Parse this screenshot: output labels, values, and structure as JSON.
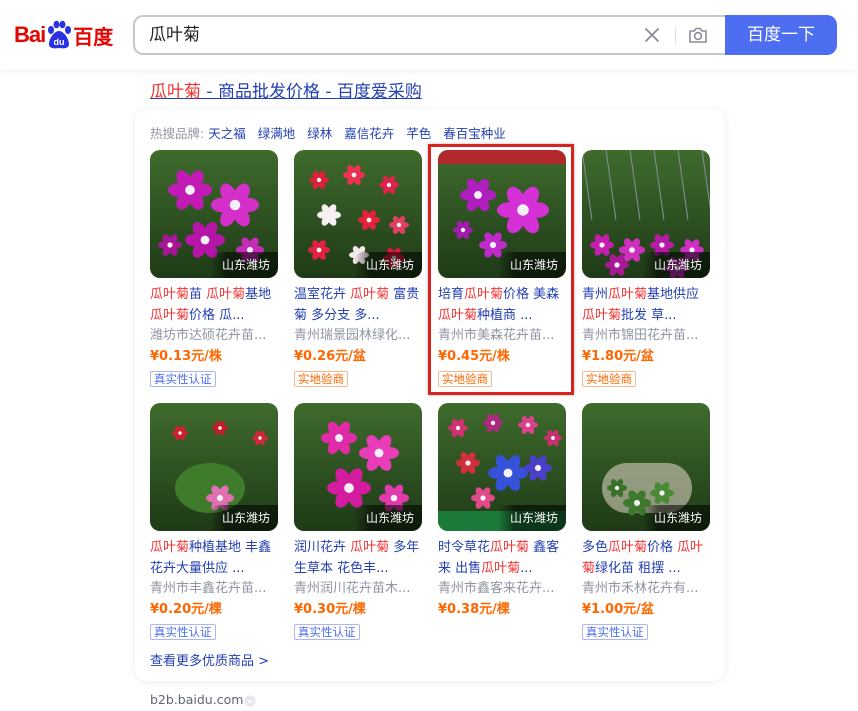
{
  "logo": {
    "bai": "Bai",
    "du": "百度"
  },
  "search": {
    "query": "瓜叶菊",
    "button": "百度一下"
  },
  "result": {
    "title_hl": "瓜叶菊",
    "title_rest": " - 商品批发价格 - 百度爱采购"
  },
  "hot_brands": {
    "label": "热搜品牌:",
    "items": [
      "天之福",
      "绿满地",
      "绿林",
      "嘉信花卉",
      "芊色",
      "春百宝种业"
    ]
  },
  "products": [
    {
      "location": "山东潍坊",
      "name_parts": [
        [
          "瓜叶菊",
          true
        ],
        [
          "苗 ",
          false
        ],
        [
          "瓜叶菊",
          true
        ],
        [
          "基地 ",
          false
        ],
        [
          "瓜叶菊",
          true
        ],
        [
          "价格 瓜...",
          false
        ]
      ],
      "seller": "潍坊市达硕花卉苗...",
      "price": "¥0.13元/株",
      "badge": "真实性认证",
      "badge_type": "auth"
    },
    {
      "location": "山东潍坊",
      "name_parts": [
        [
          "温室花卉 ",
          false
        ],
        [
          "瓜叶菊",
          true
        ],
        [
          " 富贵菊 多分支 多...",
          false
        ]
      ],
      "seller": "青州瑞景园林绿化...",
      "price": "¥0.26元/盆",
      "badge": "实地验商",
      "badge_type": "site"
    },
    {
      "location": "山东潍坊",
      "name_parts": [
        [
          "培育",
          false
        ],
        [
          "瓜叶菊",
          true
        ],
        [
          "价格 美森 ",
          false
        ],
        [
          "瓜叶菊",
          true
        ],
        [
          "种植商 ...",
          false
        ]
      ],
      "seller": "青州市美森花卉苗...",
      "price": "¥0.45元/株",
      "badge": "实地验商",
      "badge_type": "site"
    },
    {
      "location": "山东潍坊",
      "name_parts": [
        [
          "青州",
          false
        ],
        [
          "瓜叶菊",
          true
        ],
        [
          "基地供应 ",
          false
        ],
        [
          "瓜叶菊",
          true
        ],
        [
          "批发 草...",
          false
        ]
      ],
      "seller": "青州市锦田花卉苗...",
      "price": "¥1.80元/盆",
      "badge": "实地验商",
      "badge_type": "site"
    },
    {
      "location": "山东潍坊",
      "name_parts": [
        [
          "瓜叶菊",
          true
        ],
        [
          "种植基地 丰鑫花卉大量供应 ...",
          false
        ]
      ],
      "seller": "青州市丰鑫花卉苗...",
      "price": "¥0.20元/棵",
      "badge": "真实性认证",
      "badge_type": "auth"
    },
    {
      "location": "山东潍坊",
      "name_parts": [
        [
          "润川花卉 ",
          false
        ],
        [
          "瓜叶菊",
          true
        ],
        [
          " 多年生草本 花色丰...",
          false
        ]
      ],
      "seller": "青州润川花卉苗木...",
      "price": "¥0.30元/棵",
      "badge": "真实性认证",
      "badge_type": "auth"
    },
    {
      "location": "山东潍坊",
      "name_parts": [
        [
          "时令草花",
          false
        ],
        [
          "瓜叶菊",
          true
        ],
        [
          " 鑫客来 出售",
          false
        ],
        [
          "瓜叶菊",
          true
        ],
        [
          "...",
          false
        ]
      ],
      "seller": "青州市鑫客来花卉...",
      "price": "¥0.38元/棵",
      "badge": "",
      "badge_type": ""
    },
    {
      "location": "山东潍坊",
      "name_parts": [
        [
          "多色",
          false
        ],
        [
          "瓜叶菊",
          true
        ],
        [
          "价格 ",
          false
        ],
        [
          "瓜叶菊",
          true
        ],
        [
          "绿化苗 租摆 ...",
          false
        ]
      ],
      "seller": "青州市禾林花卉有...",
      "price": "¥1.00元/盆",
      "badge": "真实性认证",
      "badge_type": "auth"
    }
  ],
  "more": "查看更多优质商品 >",
  "footer": {
    "url": "b2b.baidu.com"
  },
  "colors": {
    "link": "#2440b3",
    "highlight": "#f73131",
    "price": "#ff6600",
    "button": "#4e6ef2",
    "annotation_box": "#d9231f"
  }
}
